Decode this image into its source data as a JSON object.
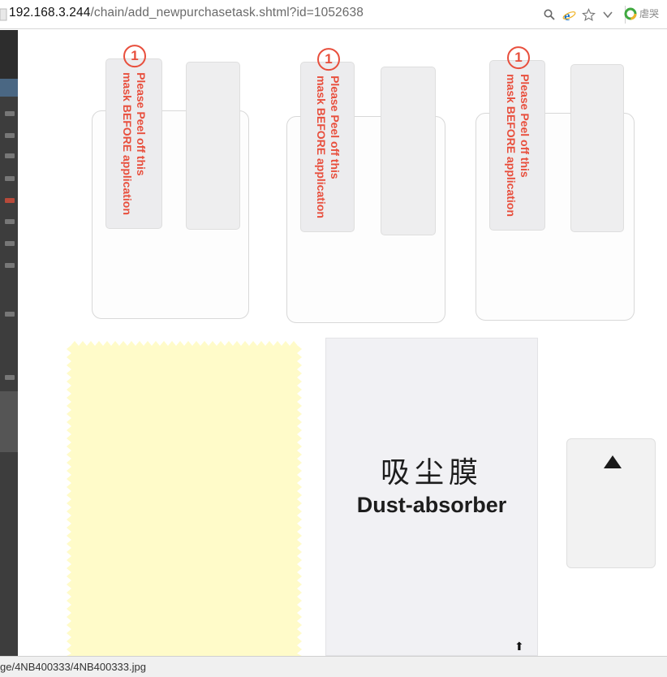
{
  "address_bar": {
    "url_host": "192.168.3.244",
    "url_path": "/chain/add_newpurchasetask.shtml?id=1052638",
    "icons": [
      "search-icon",
      "ie-logo-icon",
      "star-icon",
      "chevron-down-icon"
    ],
    "search_engine_label": "虐哭"
  },
  "product_image": {
    "films": [
      {
        "tab_number": "1",
        "tab_line1": "Please Peel off this",
        "tab_line2": "mask BEFORE application"
      },
      {
        "tab_number": "1",
        "tab_line1": "Please Peel off this",
        "tab_line2": "mask BEFORE application"
      },
      {
        "tab_number": "1",
        "tab_line1": "Please Peel off this",
        "tab_line2": "mask BEFORE application"
      }
    ],
    "dust_absorber": {
      "cn": "吸尘膜",
      "en": "Dust-absorber",
      "arrow": "⬆"
    },
    "tag_icon": "triangle-up-icon",
    "cloth_color": "#fffbc9",
    "accent_color": "#e84f3d"
  },
  "status_bar": {
    "text": "ge/4NB400333/4NB400333.jpg"
  }
}
